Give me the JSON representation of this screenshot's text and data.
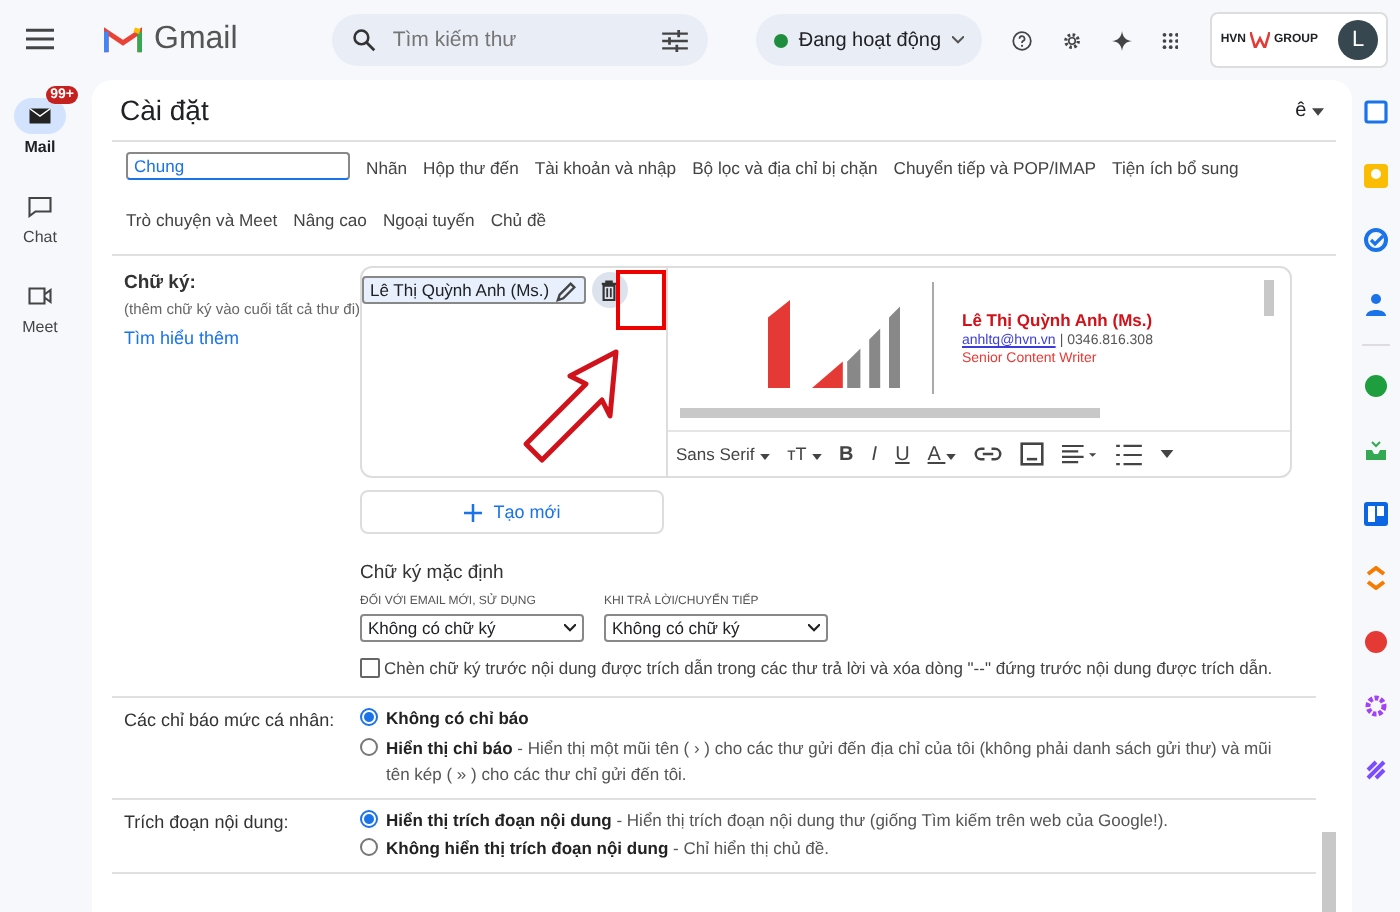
{
  "header": {
    "app_name": "Gmail",
    "search_placeholder": "Tìm kiếm thư",
    "status": "Đang hoạt động",
    "account_brand": [
      "HVN",
      "GROUP"
    ],
    "avatar_initial": "L"
  },
  "rail": [
    {
      "label": "Mail",
      "badge": "99+",
      "selected": true
    },
    {
      "label": "Chat",
      "selected": false
    },
    {
      "label": "Meet",
      "selected": false
    }
  ],
  "settings": {
    "title": "Cài đặt",
    "language": "ê"
  },
  "tabs": [
    [
      {
        "label": "Chung",
        "selected": true
      },
      {
        "label": "Nhãn",
        "selected": false
      },
      {
        "label": "Hộp thư đến",
        "selected": false
      },
      {
        "label": "Tài khoản và nhập",
        "selected": false
      },
      {
        "label": "Bộ lọc và địa chỉ bị chặn",
        "selected": false
      },
      {
        "label": "Chuyển tiếp và POP/IMAP",
        "selected": false
      },
      {
        "label": "Tiện ích bổ sung",
        "selected": false
      }
    ],
    [
      {
        "label": "Trò chuyện và Meet",
        "selected": false
      },
      {
        "label": "Nâng cao",
        "selected": false
      },
      {
        "label": "Ngoại tuyến",
        "selected": false
      },
      {
        "label": "Chủ đề",
        "selected": false
      }
    ]
  ],
  "signature": {
    "label": "Chữ ký:",
    "hint": "(thêm chữ ký vào cuối tất cả thư đi)",
    "link": "Tìm hiểu thêm",
    "items": [
      {
        "name": "Lê Thị Quỳnh Anh (Ms.)",
        "selected": true
      }
    ],
    "preview": {
      "name": "Lê Thị Quỳnh Anh (Ms.)",
      "email": "anhltq@hvn.vn",
      "separator": "|",
      "phone": "0346.816.308",
      "role": "Senior Content Writer"
    },
    "font": "Sans Serif",
    "format_glyphs": [
      "тT",
      "B",
      "I",
      "U",
      "A"
    ],
    "create_button": "Tạo mới",
    "defaults": {
      "title": "Chữ ký mặc định",
      "new_email_label": "ĐỐI VỚI EMAIL MỚI, SỬ DỤNG",
      "new_email_value": "Không có chữ ký",
      "reply_label": "KHI TRẢ LỜI/CHUYỂN TIẾP",
      "reply_value": "Không có chữ ký"
    },
    "insert_before_quote": {
      "label": "Chèn chữ ký trước nội dung được trích dẫn trong các thư trả lời và xóa dòng \"--\" đứng trước nội dung được trích dẫn.",
      "checked": false
    }
  },
  "sections": [
    {
      "label": "Các chỉ báo mức cá nhân:",
      "options": [
        {
          "title": "Không có chỉ báo",
          "selected": true
        },
        {
          "title": "Hiển thị chỉ báo",
          "description": " - Hiển thị một mũi tên ( › ) cho các thư gửi đến địa chỉ của tôi (không phải danh sách gửi thư) và mũi tên kép ( » ) cho các thư chỉ gửi đến tôi.",
          "selected": false
        }
      ]
    },
    {
      "label": "Trích đoạn nội dung:",
      "options": [
        {
          "title": "Hiển thị trích đoạn nội dung",
          "description": " - Hiển thị trích đoạn nội dung thư (giống Tìm kiếm trên web của Google!).",
          "selected": true
        },
        {
          "title": "Không hiển thị trích đoạn nội dung",
          "description": " - Chỉ hiển thị chủ đề.",
          "selected": false
        }
      ]
    }
  ]
}
